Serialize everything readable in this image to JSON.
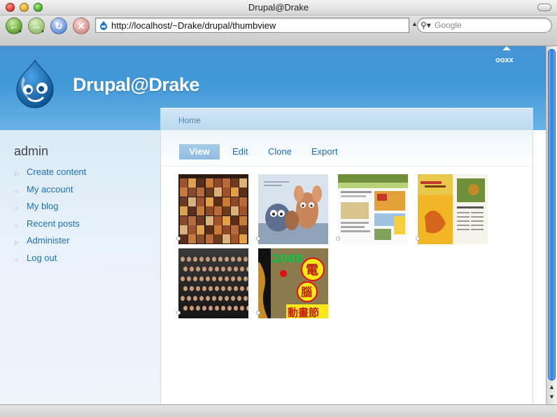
{
  "window": {
    "title": "Drupal@Drake"
  },
  "toolbar": {
    "url": "http://localhost/~Drake/drupal/thumbview",
    "search_placeholder": "Google"
  },
  "site": {
    "name": "Drupal@Drake",
    "primary_link": "ooxx"
  },
  "sidebar": {
    "title": "admin",
    "items": [
      {
        "label": "Create content",
        "bullet": "triangle"
      },
      {
        "label": "My account",
        "bullet": "circle"
      },
      {
        "label": "My blog",
        "bullet": "circle"
      },
      {
        "label": "Recent posts",
        "bullet": "circle"
      },
      {
        "label": "Administer",
        "bullet": "triangle"
      },
      {
        "label": "Log out",
        "bullet": "circle"
      }
    ]
  },
  "breadcrumb": {
    "home": "Home"
  },
  "tabs": [
    {
      "label": "View",
      "active": true
    },
    {
      "label": "Edit",
      "active": false
    },
    {
      "label": "Clone",
      "active": false
    },
    {
      "label": "Export",
      "active": false
    }
  ],
  "thumbnails": [
    {
      "subject": "photo-grid"
    },
    {
      "subject": "cartoon-rats"
    },
    {
      "subject": "website-screenshot"
    },
    {
      "subject": "magazine-spread"
    },
    {
      "subject": "group-photo"
    },
    {
      "subject": "animation-poster"
    }
  ],
  "thumb_poster_text": [
    "2008",
    "電",
    "腦",
    "動畫節"
  ],
  "colors": {
    "header": "#3d96d6",
    "link": "#1e6fb6",
    "active_tab": "#8fbce0"
  }
}
